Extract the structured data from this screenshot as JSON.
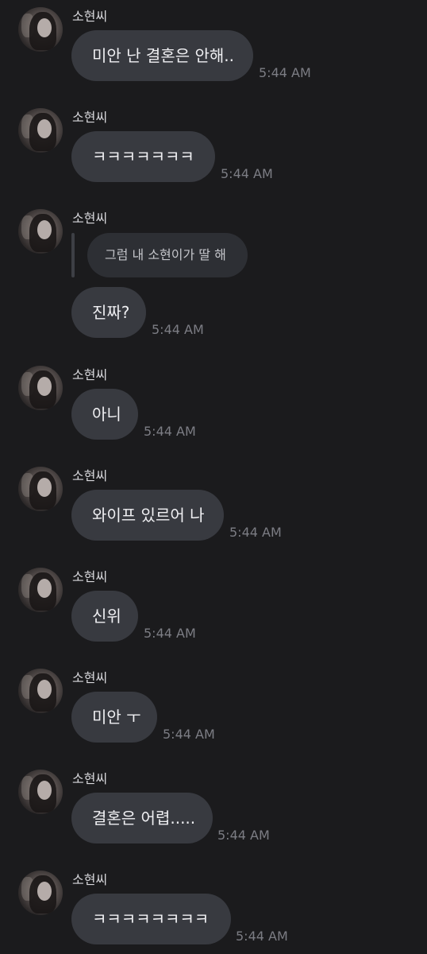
{
  "sender": {
    "name": "소현씨"
  },
  "messages": [
    {
      "text": "미안 난 결혼은 안해..",
      "time": "5:44 AM"
    },
    {
      "text": "ㅋㅋㅋㅋㅋㅋㅋ",
      "time": "5:44 AM"
    },
    {
      "reply_to": "그럼 내 소현이가 딸 해",
      "text": "진짜?",
      "time": "5:44 AM"
    },
    {
      "text": "아니",
      "time": "5:44 AM"
    },
    {
      "text": "와이프 있르어 나",
      "time": "5:44 AM"
    },
    {
      "text": "신위",
      "time": "5:44 AM"
    },
    {
      "text": "미안 ㅜ",
      "time": "5:44 AM"
    },
    {
      "text": "결혼은 어렵.....",
      "time": "5:44 AM"
    },
    {
      "text": "ㅋㅋㅋㅋㅋㅋㅋㅋ",
      "time": "5:44 AM"
    }
  ],
  "colors": {
    "background": "#1b1b1d",
    "bubble": "#383a40",
    "reply_bubble": "#2d2f34",
    "timestamp": "#7c7d84"
  }
}
